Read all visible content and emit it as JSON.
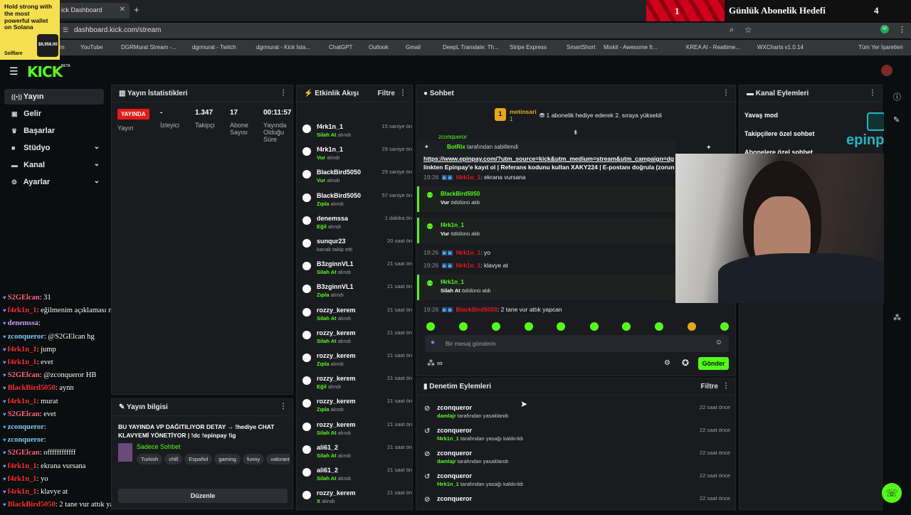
{
  "browser": {
    "tab_title": "ick Dashboard",
    "url": "dashboard.kick.com/stream",
    "bookmarks": [
      "m",
      "YouTube",
      "DGRMurat Stream -...",
      "dgrmurat - Twitch",
      "dgrmurat - Kick İsta...",
      "ChatGPT",
      "Outlook",
      "Gmail",
      "DeepL Translate: Th...",
      "Stripe Express",
      "SmartShort",
      "Mixkit - Awesome fr...",
      "KREA AI - Realtime...",
      "WXCharts v1.0.14",
      "Tüm Yer İşaretleri"
    ]
  },
  "ad": {
    "text": "Hold strong with the most powerful wallet on Solana",
    "price": "$6,956.00",
    "brand": "Solflare"
  },
  "goal": {
    "current": "1",
    "title": "Günlük Abonelik Hedefi",
    "target": "4"
  },
  "app": {
    "logo": "KICK",
    "beta": "BETA"
  },
  "sidebar": [
    {
      "label": "Yayın"
    },
    {
      "label": "Gelir"
    },
    {
      "label": "Başarlar"
    },
    {
      "label": "Stüdyo"
    },
    {
      "label": "Kanal"
    },
    {
      "label": "Ayarlar"
    }
  ],
  "stats": {
    "title": "Yayın İstatistikleri",
    "status": "YAYINDA",
    "status_label": "Yayın",
    "viewers": "-",
    "viewers_label": "İzleyici",
    "followers": "1.347",
    "followers_label": "Takipçi",
    "subs": "17",
    "subs_label": "Abone Sayısı",
    "uptime": "00:11:57",
    "uptime_label": "Yayında Olduğu Süre"
  },
  "info": {
    "title": "Yayın bilgisi",
    "stream_title": "BU YAYINDA VP DAĞITILIYOR DETAY → !hediye CHAT KLAVYEMİ YÖNETİYOR | !dc !epinpay !ig",
    "category": "Sadece Sohbet",
    "tags": [
      "Turkish",
      "chill",
      "Español",
      "gaming",
      "funny",
      "valorant"
    ],
    "edit": "Düzenle"
  },
  "activity": {
    "title": "Etkinlik Akışı",
    "filter": "Filtre",
    "events": [
      {
        "name": "f4rk1n_1",
        "action": "Silah At",
        "suffix": "alındı",
        "time": "15 saniye önce"
      },
      {
        "name": "f4rk1n_1",
        "action": "Vur",
        "suffix": "alındı",
        "time": "29 saniye önce"
      },
      {
        "name": "BlackBird5050",
        "action": "Vur",
        "suffix": "alındı",
        "time": "29 saniye önce"
      },
      {
        "name": "BlackBird5050",
        "action": "Zıpla",
        "suffix": "alındı",
        "time": "57 saniye önce"
      },
      {
        "name": "denemssa",
        "action": "Eğil",
        "suffix": "alındı",
        "time": "1 dakika önce"
      },
      {
        "name": "sunqur23",
        "action": "",
        "suffix": "kanalı takip etti",
        "time": "20 saat önce"
      },
      {
        "name": "B3zginnVL1",
        "action": "Silah At",
        "suffix": "alındı",
        "time": "21 saat önce"
      },
      {
        "name": "B3zginnVL1",
        "action": "Zıpla",
        "suffix": "alındı",
        "time": "21 saat önce"
      },
      {
        "name": "rozzy_kerem",
        "action": "Silah At",
        "suffix": "alındı",
        "time": "21 saat önce"
      },
      {
        "name": "rozzy_kerem",
        "action": "Silah At",
        "suffix": "alındı",
        "time": "21 saat önce"
      },
      {
        "name": "rozzy_kerem",
        "action": "Zıpla",
        "suffix": "alındı",
        "time": "21 saat önce"
      },
      {
        "name": "rozzy_kerem",
        "action": "Eğil",
        "suffix": "alındı",
        "time": "21 saat önce"
      },
      {
        "name": "rozzy_kerem",
        "action": "Zıpla",
        "suffix": "alındı",
        "time": "21 saat önce"
      },
      {
        "name": "rozzy_kerem",
        "action": "Silah At",
        "suffix": "alındı",
        "time": "21 saat önce"
      },
      {
        "name": "ali61_2",
        "action": "Silah At",
        "suffix": "alındı",
        "time": "21 saat önce"
      },
      {
        "name": "ali61_2",
        "action": "Silah At",
        "suffix": "alındı",
        "time": "21 saat önce"
      },
      {
        "name": "rozzy_kerem",
        "action": "X",
        "suffix": "alındı",
        "time": "21 saat önce"
      },
      {
        "name": "zconqueror",
        "action": "",
        "suffix": "",
        "time": "22 saat önce"
      }
    ]
  },
  "chat": {
    "title": "Sohbet",
    "gift_user": "metinsari",
    "gift_count": "1",
    "gift_text": "1 abonelik hediye ederek 2. sıraya yükseldi",
    "pinned_by": "BotRix",
    "pinned_suffix": "tarafından sabitlendi",
    "pinned_link": "https://www.epinpay.com/?utm_source=kick&utm_medium=stream&utm_campaign=dg",
    "pinned_text": "linkten Epinpay'e kayıt ol | Referans kodunu kullan XAKY224 | E-postanı doğrula (zorun",
    "partial_user": "zconqueror",
    "lines": [
      {
        "time": "19:26",
        "user": "f4rk1n_1",
        "msg": ": ekrana vursana"
      },
      {
        "time": "19:26",
        "user": "f4rk1n_1",
        "msg": ": yo"
      },
      {
        "time": "19:26",
        "user": "f4rk1n_1",
        "msg": ": klavye at"
      },
      {
        "time": "19:26",
        "user": "BlackBird5050",
        "msg": ": 2 tane vur attık yapcan"
      }
    ],
    "rewards": [
      {
        "name": "BlackBird5050",
        "reward": "Vur",
        "suffix": "ödülünü aldı"
      },
      {
        "name": "f4rk1n_1",
        "reward": "Vur",
        "suffix": "ödülünü aldı"
      },
      {
        "name": "f4rk1n_1",
        "reward": "Silah At",
        "suffix": "ödülünü aldı"
      }
    ],
    "placeholder": "Bir mesaj gönderin",
    "send": "Gönder"
  },
  "moderation": {
    "title": "Denetim Eylemleri",
    "filter": "Filtre",
    "items": [
      {
        "user": "zconqueror",
        "by": "damlajr",
        "suffix": "tarafından yasaklandı",
        "time": "22 saat önce"
      },
      {
        "user": "zconqueror",
        "by": "f4rk1n_1",
        "suffix": "tarafından yasağı kaldırıldı",
        "time": "22 saat önce"
      },
      {
        "user": "zconqueror",
        "by": "damlajr",
        "suffix": "tarafından yasaklandı",
        "time": "22 saat önce"
      },
      {
        "user": "zconqueror",
        "by": "f4rk1n_1",
        "suffix": "tarafından yasağı kaldırıldı",
        "time": "22 saat önce"
      },
      {
        "user": "zconqueror",
        "by": "",
        "suffix": "",
        "time": "22 saat önce"
      }
    ]
  },
  "channel": {
    "title": "Kanal Eylemleri",
    "items": [
      "Yavaş mod",
      "Takipçilere özel sohbet",
      "Abonelere özel sohbet"
    ]
  },
  "overlay_chat": [
    {
      "user": "S2GElcan",
      "msg": ": 31",
      "color": "#ff6680"
    },
    {
      "user": "f4rk1n_1",
      "msg": ": eğilmenim açıklaması ne öyle",
      "color": "#ff3030"
    },
    {
      "user": "denemssa",
      "msg": ":",
      "color": "#c9a0ff"
    },
    {
      "user": "zconqueror",
      "msg": ": @S2GElcan hg",
      "color": "#7fd0ff"
    },
    {
      "user": "f4rk1n_1",
      "msg": ": jump",
      "color": "#ff3030"
    },
    {
      "user": "f4rk1n_1",
      "msg": ": evet",
      "color": "#ff3030"
    },
    {
      "user": "S2GElcan",
      "msg": ": @zconqueror HB",
      "color": "#ff6680"
    },
    {
      "user": "BlackBird5050",
      "msg": ": aynn",
      "color": "#ff3030"
    },
    {
      "user": "f4rk1n_1",
      "msg": ": murat",
      "color": "#ff3030"
    },
    {
      "user": "S2GElcan",
      "msg": ": evet",
      "color": "#ff6680"
    },
    {
      "user": "zconqueror",
      "msg": ":",
      "color": "#7fd0ff"
    },
    {
      "user": "zconqueror",
      "msg": ":",
      "color": "#7fd0ff"
    },
    {
      "user": "S2GElcan",
      "msg": ": offffffffffff",
      "color": "#ff6680"
    },
    {
      "user": "f4rk1n_1",
      "msg": ": ekrana vursana",
      "color": "#ff3030"
    },
    {
      "user": "f4rk1n_1",
      "msg": ": yo",
      "color": "#ff3030"
    },
    {
      "user": "f4rk1n_1",
      "msg": ": klavye at",
      "color": "#ff3030"
    },
    {
      "user": "BlackBird5050",
      "msg": ": 2 tane vur attık yapcan",
      "color": "#ff3030"
    }
  ],
  "epinpay": "epinpay"
}
